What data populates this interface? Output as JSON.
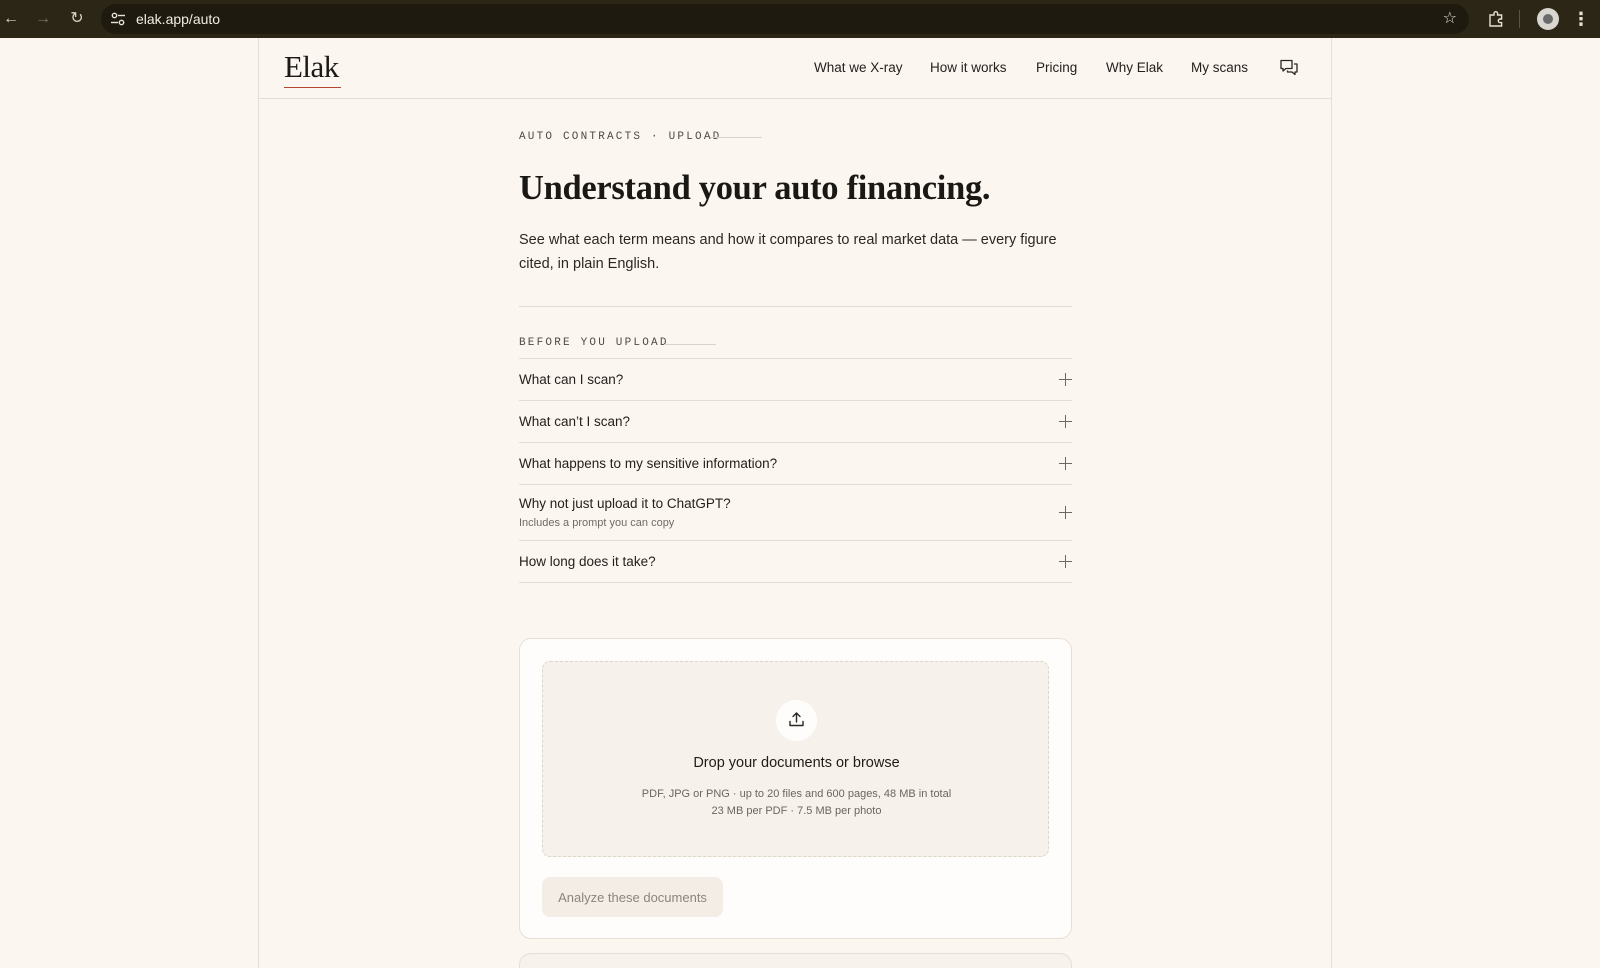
{
  "browser": {
    "url": "elak.app/auto"
  },
  "brand": {
    "logo": "Elak"
  },
  "nav": {
    "items": [
      "What we X-ray",
      "How it works",
      "Pricing",
      "Why Elak",
      "My scans"
    ]
  },
  "hero": {
    "eyebrow": "AUTO CONTRACTS · UPLOAD",
    "title": "Understand your auto financing.",
    "subtitle": "See what each term means and how it compares to real market data — every figure cited, in plain English."
  },
  "faq": {
    "eyebrow": "BEFORE YOU UPLOAD",
    "items": [
      {
        "question": "What can I scan?"
      },
      {
        "question": "What can’t I scan?"
      },
      {
        "question": "What happens to my sensitive information?"
      },
      {
        "question": "Why not just upload it to ChatGPT?",
        "hint": "Includes a prompt you can copy"
      },
      {
        "question": "How long does it take?"
      }
    ]
  },
  "upload": {
    "title": "Drop your documents or browse",
    "meta_line1": "PDF, JPG or PNG · up to 20 files and 600 pages, 48 MB in total",
    "meta_line2": "23 MB per PDF · 7.5 MB per photo",
    "button": "Analyze these documents"
  },
  "icons": {
    "back": "arrow-left-icon",
    "forward": "arrow-right-icon",
    "reload": "reload-icon",
    "site_settings": "tune-icon",
    "bookmark": "star-icon",
    "extensions": "puzzle-icon",
    "profile": "avatar",
    "menu": "kebab-menu-icon",
    "chat": "chat-bubbles-icon",
    "upload": "upload-icon",
    "expand": "plus-icon"
  },
  "colors": {
    "background": "#fcf6f1",
    "chrome": "#2c2617",
    "text": "#1c1a17",
    "accent": "#b5452f"
  }
}
